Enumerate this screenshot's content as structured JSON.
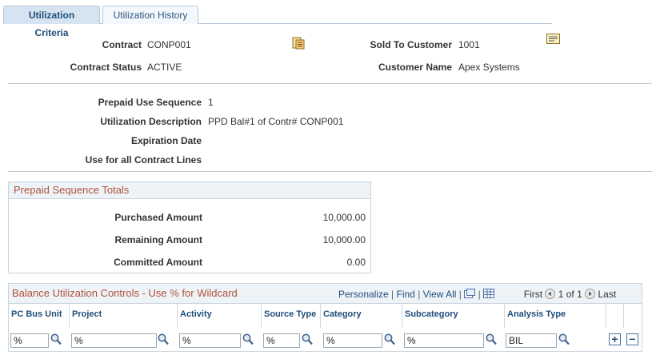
{
  "tabs": [
    {
      "label": "Utilization Criteria"
    },
    {
      "label": "Utilization History"
    }
  ],
  "header": {
    "contract_label": "Contract",
    "contract_value": "CONP001",
    "contract_status_label": "Contract Status",
    "contract_status_value": "ACTIVE",
    "sold_to_label": "Sold To Customer",
    "sold_to_value": "1001",
    "customer_name_label": "Customer Name",
    "customer_name_value": "Apex Systems"
  },
  "details": {
    "sequence_label": "Prepaid Use Sequence",
    "sequence_value": "1",
    "description_label": "Utilization Description",
    "description_value": "PPD Bal#1 of Contr# CONP001",
    "expiration_label": "Expiration Date",
    "use_all_label": "Use for all Contract Lines"
  },
  "totals": {
    "title": "Prepaid Sequence Totals",
    "purchased_label": "Purchased Amount",
    "purchased_value": "10,000.00",
    "remaining_label": "Remaining Amount",
    "remaining_value": "10,000.00",
    "committed_label": "Committed Amount",
    "committed_value": "0.00"
  },
  "grid": {
    "title": "Balance Utilization Controls - Use % for Wildcard",
    "personalize": "Personalize",
    "find": "Find",
    "view_all": "View All",
    "first": "First",
    "count": "1 of 1",
    "last": "Last",
    "columns": [
      "PC Bus Unit",
      "Project",
      "Activity",
      "Source Type",
      "Category",
      "Subcategory",
      "Analysis Type"
    ],
    "row": [
      "%",
      "%",
      "%",
      "%",
      "%",
      "%",
      "BIL"
    ]
  },
  "colors": {
    "tab_active_bg": "#d6e3f0",
    "group_title": "#b0523a",
    "link": "#1f4e79"
  }
}
